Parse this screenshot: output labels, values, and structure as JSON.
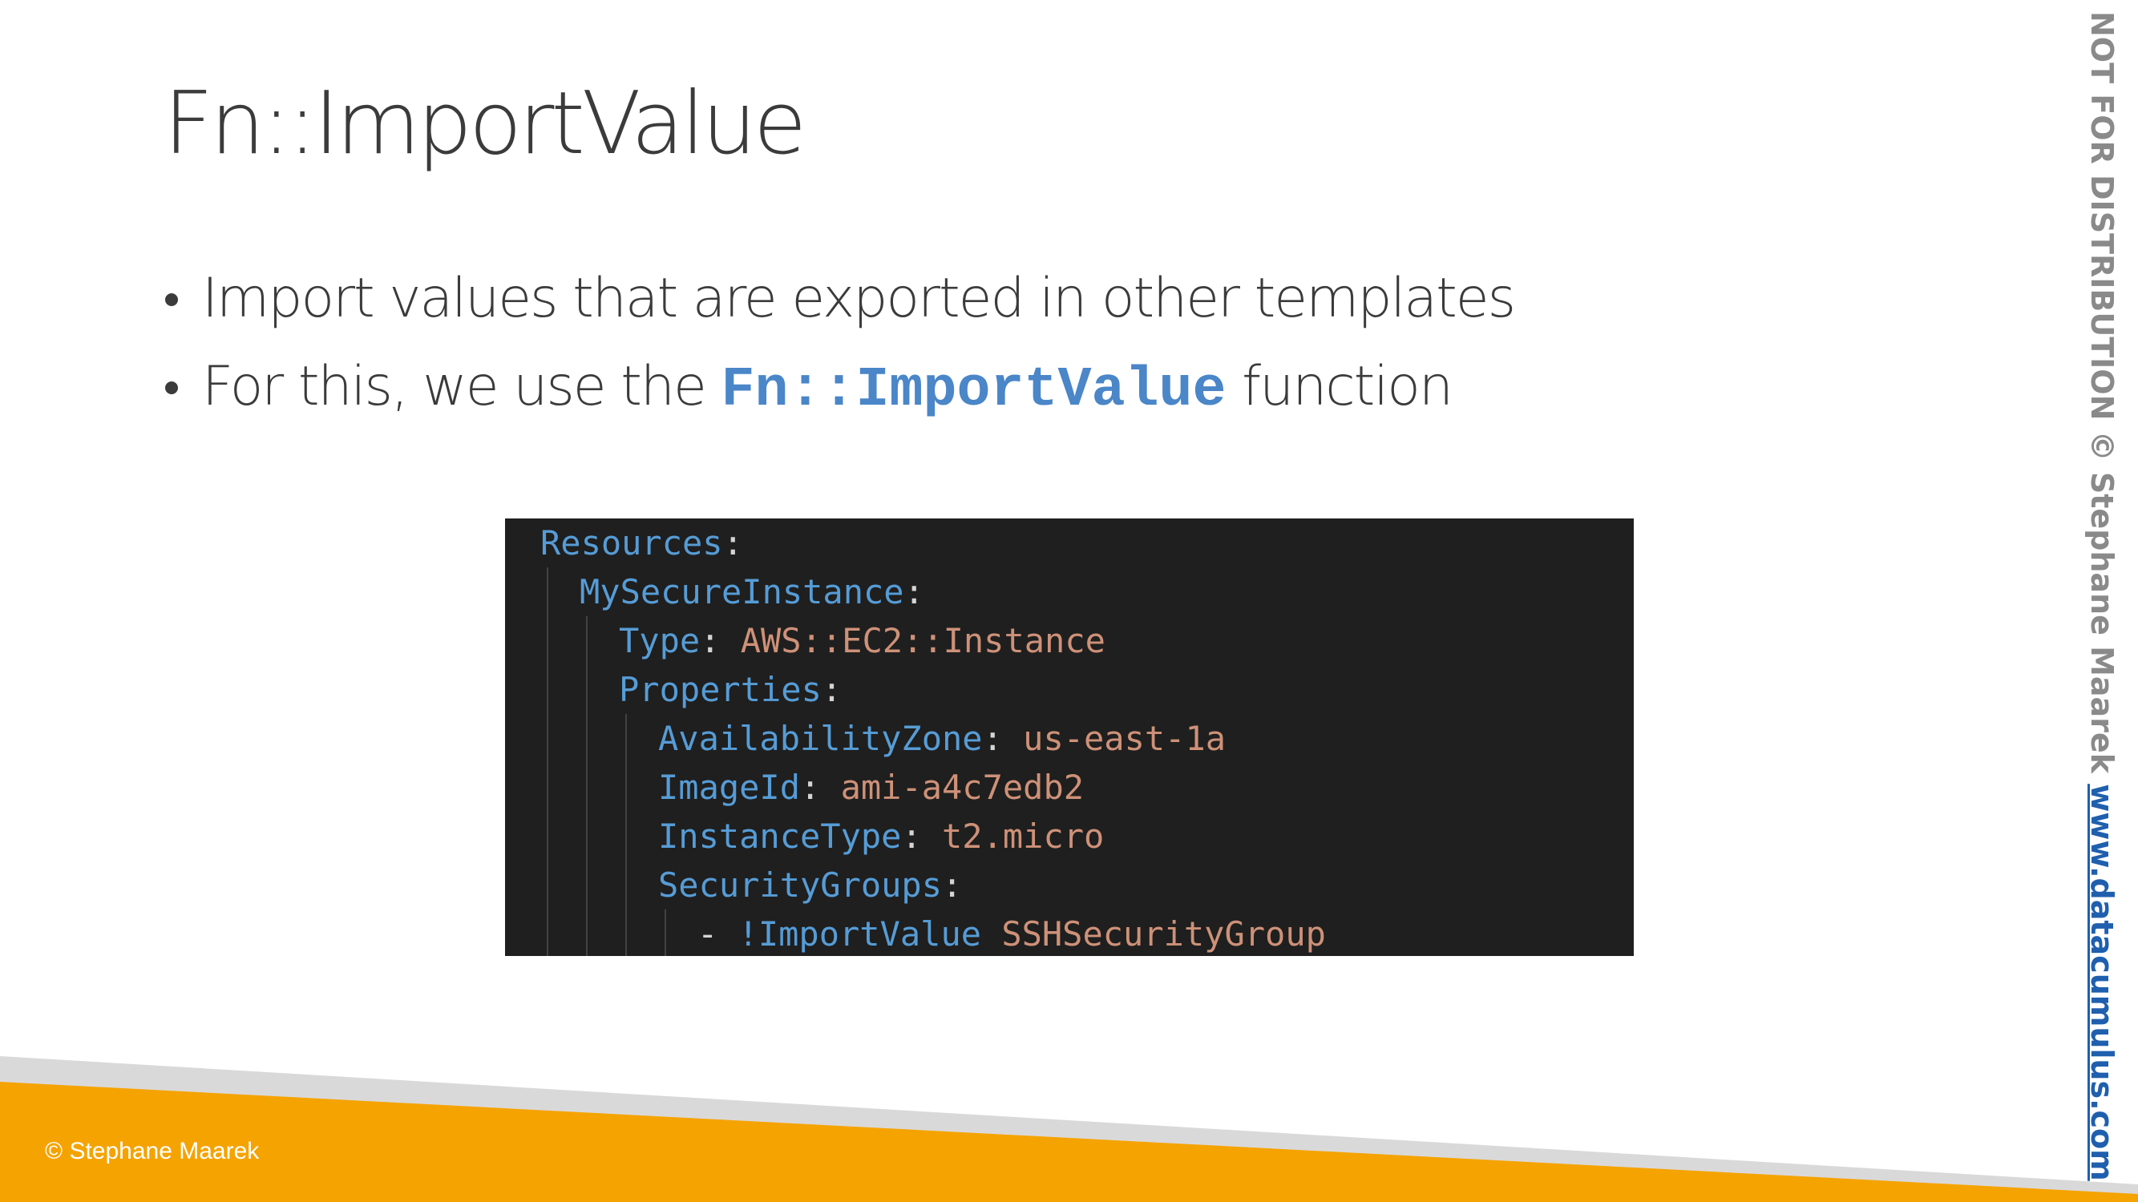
{
  "slide": {
    "title": "Fn::ImportValue",
    "bullets": [
      {
        "text": "Import values that are exported in other templates"
      },
      {
        "before": "For this, we use the ",
        "code": "Fn::ImportValue",
        "after": " function"
      }
    ]
  },
  "code_block": {
    "lines": [
      {
        "indent": 0,
        "key": "Resources",
        "sep": ":",
        "value": ""
      },
      {
        "indent": 1,
        "key": "MySecureInstance",
        "sep": ":",
        "value": ""
      },
      {
        "indent": 2,
        "key": "Type",
        "sep": ": ",
        "value": "AWS::EC2::Instance"
      },
      {
        "indent": 2,
        "key": "Properties",
        "sep": ":",
        "value": ""
      },
      {
        "indent": 3,
        "key": "AvailabilityZone",
        "sep": ": ",
        "value": "us-east-1a"
      },
      {
        "indent": 3,
        "key": "ImageId",
        "sep": ": ",
        "value": "ami-a4c7edb2"
      },
      {
        "indent": 3,
        "key": "InstanceType",
        "sep": ": ",
        "value": "t2.micro"
      },
      {
        "indent": 3,
        "key": "SecurityGroups",
        "sep": ":",
        "value": ""
      },
      {
        "indent": 4,
        "dash": "- ",
        "key": "!ImportValue",
        "sep": " ",
        "value": "SSHSecurityGroup"
      }
    ]
  },
  "watermark": {
    "text": "NOT FOR DISTRIBUTION © Stephane Maarek ",
    "link": "www.datacumulus.com"
  },
  "footer": {
    "copyright": "© Stephane Maarek"
  },
  "colors": {
    "band_orange": "#f5a300",
    "band_gray": "#d9d9d9",
    "code_background": "#1f1f1f",
    "code_key": "#569cd6",
    "code_value": "#ce9178",
    "inline_code": "#4a86c8",
    "link": "#1f5fae"
  }
}
